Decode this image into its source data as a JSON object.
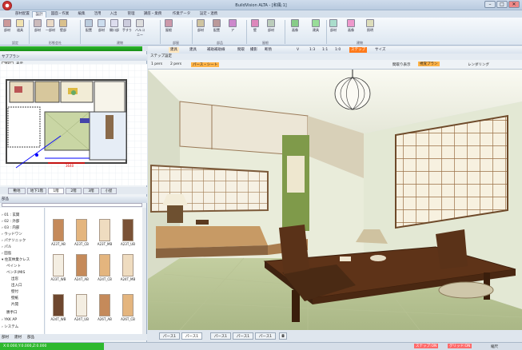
{
  "window": {
    "title": "BuildVision ALTA - [和風:1]",
    "buttons": [
      "–",
      "□",
      "✕"
    ]
  },
  "tabs": [
    "部材配置",
    "設計",
    "図面・作業",
    "編集",
    "活用",
    "入出",
    "管理",
    "講座・業務",
    "作業データ",
    "設定・連携"
  ],
  "active_tab": 1,
  "ribbon": {
    "buttons": [
      "部材",
      "道具",
      "部材",
      "一部材",
      "壁部",
      "配置",
      "部材",
      "開口部",
      "手すり",
      "バルコニー",
      "屋根",
      "部材",
      "配置",
      "ア",
      "壁",
      "部材",
      "画像",
      "建具",
      "部材",
      "画像",
      "照明"
    ],
    "groups": [
      "設定",
      "形態会社",
      "建物",
      "部屋",
      "部品",
      "屋根",
      "建物"
    ]
  },
  "viewbar": {
    "labels": [
      "建具",
      "建具",
      "補助補助線",
      "間取",
      "撮影",
      "断熱",
      "V",
      "1:3",
      "1:1",
      "1:0",
      "ステップ",
      "サイズ"
    ]
  },
  "left": {
    "plan_header": "サブプラン",
    "plan_tools": [
      "選択",
      "表示"
    ],
    "dimension": "3640",
    "floor_tabs": [
      "敷地",
      "地下1階",
      "1階",
      "2階",
      "3階",
      "小屋"
    ],
    "active_floor": 2,
    "catalog_header": "部品",
    "tree": [
      "01 : 玄関",
      "02 : 外部",
      "03 : 内部",
      "ウッドワン",
      "パナソニック",
      "パル",
      "田島",
      "住友林業クレス",
      "ペイント",
      "ベンチ(MIS",
      "出窓",
      "出入口",
      "壁付",
      "壁紙",
      "片開",
      "勝手口",
      "YKK AP",
      "システム"
    ],
    "tiles": [
      "A23T_AB",
      "A23T_CB",
      "A23T_MB",
      "A23T_UB",
      "A23T_WB",
      "A24T_AB",
      "A24T_CB",
      "A24T_MB",
      "A24T_WB",
      "A24T_UB",
      "A26T_AB",
      "A26T_CB"
    ],
    "bottom_tabs": [
      "部材",
      "建材",
      "部品"
    ]
  },
  "viewer": {
    "step_header": "ステップ設定",
    "breadcrumb": "パース・シート",
    "toolbar_left": [
      "1 pers",
      "2 pers"
    ],
    "toolbar_right": [
      "間取り表示",
      "視覚プラン",
      "レンダリング"
    ],
    "view_tabs": [
      "パース1",
      "パース1",
      "パース1",
      "パース1",
      "パース1"
    ],
    "active_view": 1
  },
  "status": {
    "coords": "X:0.000,Y:0.000,Z:0.000",
    "modes": [
      "スナップ:ON",
      "グリッド:ON"
    ],
    "zoom": "縮尺"
  },
  "colors": {
    "accent": "#2eb82e",
    "select": "#ff6a00",
    "wall": "#e9ecda",
    "tatami": "#c9d6a4"
  }
}
